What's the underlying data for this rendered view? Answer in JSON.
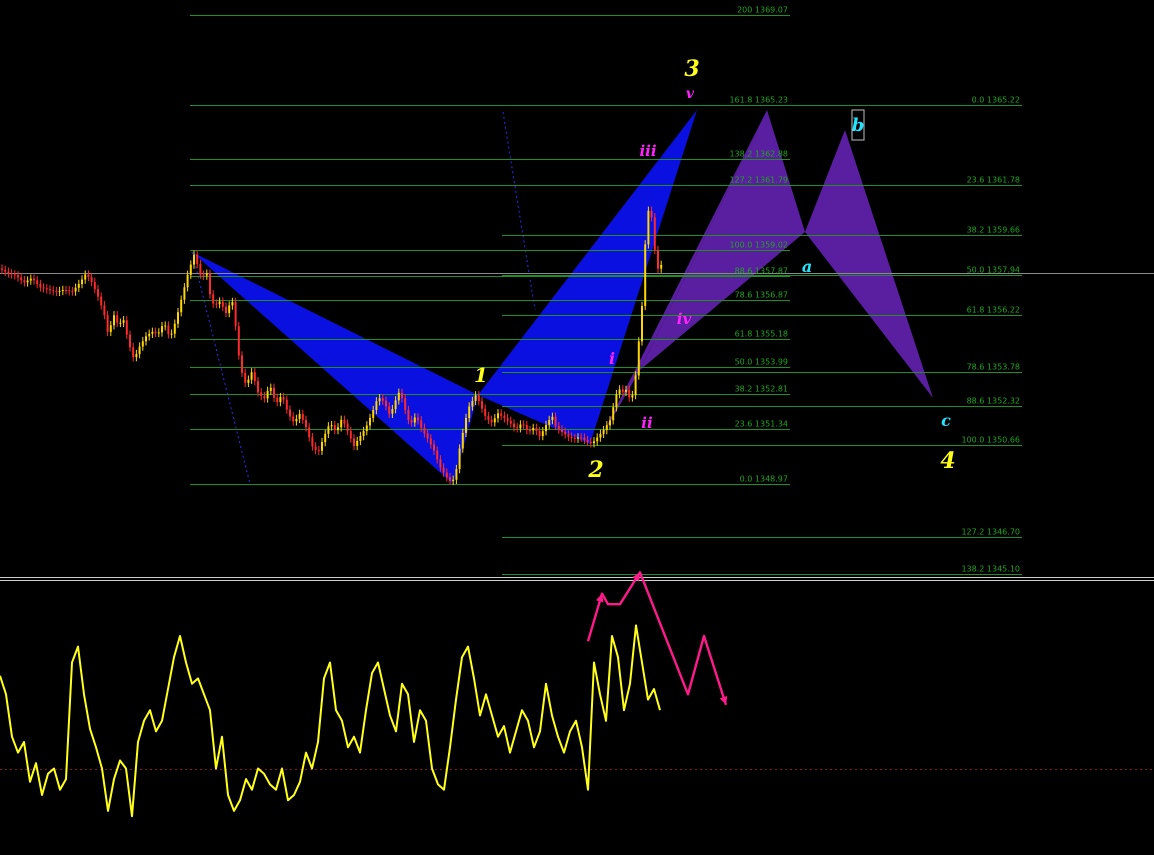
{
  "colors": {
    "background": "#000000",
    "fib_line": "#1f8f1f",
    "fib_text": "#1fa51f",
    "bull_candle": "#ffd700",
    "bear_candle": "#ff2a2a",
    "pattern_blue": "#0a10e0",
    "pattern_purple": "#5a1ea0",
    "oscillator": "#ffff1a",
    "projection": "#ff1a8c",
    "wave_yellow": "#ffff1a",
    "wave_magenta": "#ff22ff",
    "wave_cyan": "#22e5ff"
  },
  "chart_data": [
    {
      "type": "candlestick",
      "title": "",
      "ylim": [
        1343.5,
        1370.0
      ],
      "grid": false,
      "price_line": 1358.0,
      "fib_levels": [
        {
          "label": "200 1369.07",
          "price": 1369.07
        },
        {
          "label": "161.8 1365.23",
          "price": 1365.23
        },
        {
          "label": "138.2 1362.88",
          "price": 1362.88
        },
        {
          "label": "127.2 1361.79",
          "price": 1361.79
        },
        {
          "label": "100.0 1359.02",
          "price": 1359.02
        },
        {
          "label": "88.6 1357.87",
          "price": 1357.87
        },
        {
          "label": "78.6 1356.87",
          "price": 1356.87
        },
        {
          "label": "61.8 1355.18",
          "price": 1355.18
        },
        {
          "label": "50.0 1353.99",
          "price": 1353.99
        },
        {
          "label": "38.2 1352.81",
          "price": 1352.81
        },
        {
          "label": "23.6 1351.34",
          "price": 1351.34
        },
        {
          "label": "0.0 1348.97",
          "price": 1348.97
        }
      ],
      "fib_extension_levels": [
        {
          "label": "127.2 1346.70",
          "price": 1346.7
        },
        {
          "label": "138.2 1345.10",
          "price": 1345.1
        }
      ],
      "fib_right_levels": [
        {
          "label": "0.0 1365.22",
          "price": 1365.22
        },
        {
          "label": "23.6 1361.78",
          "price": 1361.78
        },
        {
          "label": "38.2 1359.66",
          "price": 1359.66
        },
        {
          "label": "50.0 1357.94",
          "price": 1357.94
        },
        {
          "label": "61.8 1356.22",
          "price": 1356.22
        },
        {
          "label": "78.6 1353.78",
          "price": 1353.78
        },
        {
          "label": "88.6 1352.32",
          "price": 1352.32
        },
        {
          "label": "100.0 1350.66",
          "price": 1350.66
        }
      ],
      "close_path": [
        [
          0,
          1358.2
        ],
        [
          8,
          1358.0
        ],
        [
          16,
          1357.9
        ],
        [
          24,
          1357.6
        ],
        [
          32,
          1357.8
        ],
        [
          40,
          1357.4
        ],
        [
          48,
          1357.3
        ],
        [
          56,
          1357.2
        ],
        [
          64,
          1357.3
        ],
        [
          72,
          1357.2
        ],
        [
          80,
          1357.6
        ],
        [
          86,
          1358.0
        ],
        [
          92,
          1357.6
        ],
        [
          98,
          1357.0
        ],
        [
          104,
          1356.3
        ],
        [
          108,
          1355.4
        ],
        [
          114,
          1356.2
        ],
        [
          118,
          1355.8
        ],
        [
          124,
          1356.0
        ],
        [
          128,
          1355.1
        ],
        [
          134,
          1354.3
        ],
        [
          140,
          1354.9
        ],
        [
          146,
          1355.3
        ],
        [
          152,
          1355.5
        ],
        [
          158,
          1355.4
        ],
        [
          164,
          1355.9
        ],
        [
          170,
          1355.2
        ],
        [
          176,
          1356.0
        ],
        [
          182,
          1357.0
        ],
        [
          188,
          1358.0
        ],
        [
          194,
          1358.8
        ],
        [
          198,
          1358.3
        ],
        [
          202,
          1357.7
        ],
        [
          206,
          1358.2
        ],
        [
          210,
          1357.1
        ],
        [
          214,
          1356.6
        ],
        [
          220,
          1356.8
        ],
        [
          226,
          1356.3
        ],
        [
          232,
          1356.9
        ],
        [
          236,
          1355.6
        ],
        [
          240,
          1354.0
        ],
        [
          246,
          1353.2
        ],
        [
          252,
          1353.8
        ],
        [
          258,
          1352.9
        ],
        [
          264,
          1352.6
        ],
        [
          270,
          1353.2
        ],
        [
          276,
          1352.4
        ],
        [
          282,
          1352.8
        ],
        [
          288,
          1352.0
        ],
        [
          294,
          1351.6
        ],
        [
          300,
          1352.0
        ],
        [
          306,
          1351.4
        ],
        [
          312,
          1350.6
        ],
        [
          318,
          1350.3
        ],
        [
          324,
          1351.0
        ],
        [
          330,
          1351.6
        ],
        [
          336,
          1351.2
        ],
        [
          342,
          1351.8
        ],
        [
          348,
          1351.2
        ],
        [
          354,
          1350.6
        ],
        [
          360,
          1351.0
        ],
        [
          366,
          1351.4
        ],
        [
          372,
          1352.0
        ],
        [
          378,
          1352.7
        ],
        [
          384,
          1352.5
        ],
        [
          390,
          1351.9
        ],
        [
          396,
          1352.6
        ],
        [
          400,
          1353.0
        ],
        [
          404,
          1352.3
        ],
        [
          410,
          1351.5
        ],
        [
          416,
          1351.9
        ],
        [
          422,
          1351.3
        ],
        [
          428,
          1350.9
        ],
        [
          434,
          1350.4
        ],
        [
          440,
          1349.7
        ],
        [
          446,
          1349.3
        ],
        [
          452,
          1349.0
        ],
        [
          456,
          1349.5
        ],
        [
          460,
          1350.6
        ],
        [
          464,
          1351.4
        ],
        [
          468,
          1352.2
        ],
        [
          472,
          1352.5
        ],
        [
          476,
          1352.8
        ],
        [
          480,
          1352.4
        ],
        [
          486,
          1351.8
        ],
        [
          492,
          1351.6
        ],
        [
          498,
          1352.0
        ],
        [
          504,
          1351.8
        ],
        [
          510,
          1351.6
        ],
        [
          516,
          1351.3
        ],
        [
          522,
          1351.6
        ],
        [
          528,
          1351.2
        ],
        [
          534,
          1351.4
        ],
        [
          540,
          1351.0
        ],
        [
          546,
          1351.5
        ],
        [
          552,
          1351.9
        ],
        [
          556,
          1351.4
        ],
        [
          562,
          1351.2
        ],
        [
          568,
          1351.0
        ],
        [
          574,
          1350.9
        ],
        [
          580,
          1351.0
        ],
        [
          586,
          1350.8
        ],
        [
          592,
          1350.7
        ],
        [
          598,
          1351.0
        ],
        [
          604,
          1351.3
        ],
        [
          610,
          1351.7
        ],
        [
          614,
          1352.4
        ],
        [
          618,
          1353.1
        ],
        [
          622,
          1352.9
        ],
        [
          626,
          1353.0
        ],
        [
          630,
          1352.6
        ],
        [
          634,
          1352.9
        ],
        [
          638,
          1354.7
        ],
        [
          642,
          1356.6
        ],
        [
          646,
          1359.9
        ],
        [
          650,
          1361.2
        ],
        [
          654,
          1359.2
        ],
        [
          658,
          1358.2
        ],
        [
          662,
          1358.4
        ]
      ]
    },
    {
      "type": "line",
      "title": "",
      "ylim": [
        0,
        100
      ],
      "grid": false,
      "zero_line": 30,
      "series": [
        {
          "x": [
            0,
            6,
            12,
            18,
            24,
            30,
            36,
            42,
            48,
            54,
            60,
            66,
            72,
            78,
            84,
            90,
            96,
            102,
            108,
            114,
            120,
            126,
            132,
            138,
            144,
            150,
            156,
            162,
            168,
            174,
            180,
            186,
            192,
            198,
            204,
            210,
            216,
            222,
            228,
            234,
            240,
            246,
            252,
            258,
            264,
            270,
            276,
            282,
            288,
            294,
            300,
            306,
            312,
            318,
            324,
            330,
            336,
            342,
            348,
            354,
            360,
            366,
            372,
            378,
            384,
            390,
            396,
            402,
            408,
            414,
            420,
            426,
            432,
            438,
            444,
            450,
            456,
            462,
            468,
            474,
            480,
            486,
            492,
            498,
            504,
            510,
            516,
            522,
            528,
            534,
            540,
            546,
            552,
            558,
            564,
            570,
            576,
            582,
            588,
            594,
            600,
            606,
            612,
            618,
            624,
            630,
            636,
            642,
            648,
            654,
            660
          ],
          "values": [
            65,
            58,
            42,
            36,
            40,
            25,
            32,
            20,
            28,
            30,
            22,
            26,
            70,
            76,
            58,
            45,
            38,
            30,
            14,
            26,
            33,
            30,
            12,
            40,
            48,
            52,
            44,
            48,
            60,
            72,
            80,
            70,
            62,
            64,
            58,
            52,
            30,
            42,
            20,
            14,
            18,
            26,
            22,
            30,
            28,
            24,
            22,
            30,
            18,
            20,
            25,
            36,
            30,
            40,
            64,
            70,
            52,
            48,
            38,
            42,
            36,
            52,
            66,
            70,
            60,
            50,
            44,
            62,
            58,
            40,
            52,
            48,
            30,
            24,
            22,
            38,
            56,
            72,
            76,
            64,
            50,
            58,
            50,
            42,
            46,
            36,
            44,
            52,
            48,
            38,
            44,
            62,
            50,
            42,
            36,
            44,
            48,
            38,
            22,
            70,
            58,
            48,
            80,
            72,
            52,
            62,
            84,
            70,
            56,
            60,
            52
          ]
        },
        {
          "name": "",
          "x": [
            588,
            602,
            608,
            620,
            640,
            688,
            704,
            726
          ],
          "values": [
            78,
            96,
            92,
            92,
            104,
            58,
            80,
            54
          ]
        }
      ]
    }
  ],
  "wave_labels": [
    {
      "text": "3",
      "color": "wave_yellow"
    },
    {
      "text": "v",
      "color": "wave_magenta"
    },
    {
      "text": "iii",
      "color": "wave_magenta"
    },
    {
      "text": "b",
      "color": "wave_cyan"
    },
    {
      "text": "a",
      "color": "wave_cyan"
    },
    {
      "text": "iv",
      "color": "wave_magenta"
    },
    {
      "text": "i",
      "color": "wave_magenta"
    },
    {
      "text": "1",
      "color": "wave_yellow"
    },
    {
      "text": "ii",
      "color": "wave_magenta"
    },
    {
      "text": "2",
      "color": "wave_yellow"
    },
    {
      "text": "c",
      "color": "wave_cyan"
    },
    {
      "text": "4",
      "color": "wave_yellow"
    }
  ]
}
